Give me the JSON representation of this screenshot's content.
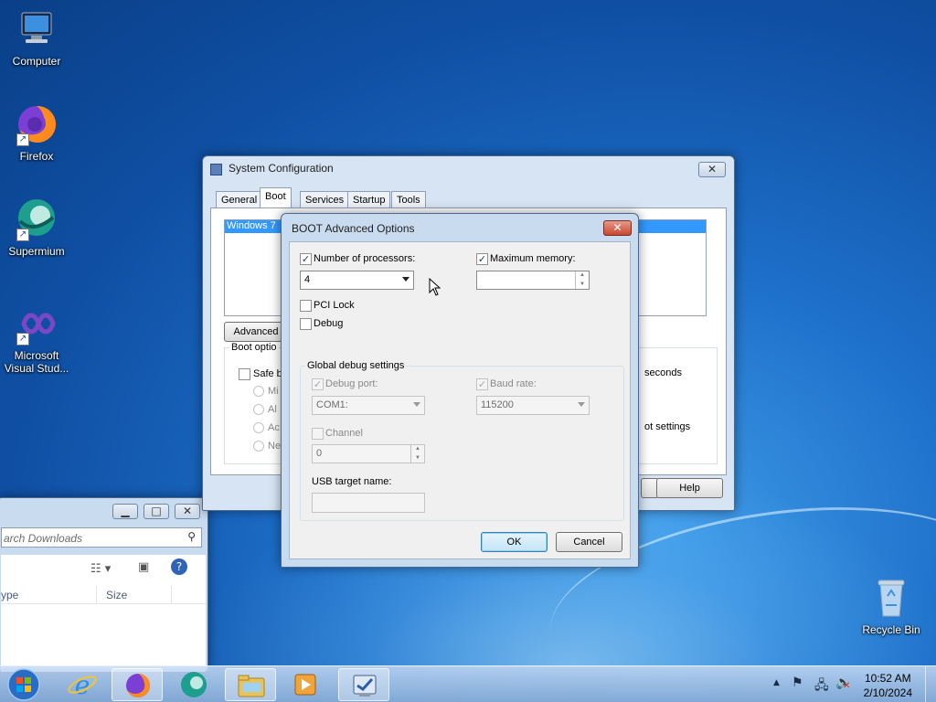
{
  "desktop": {
    "icons": [
      {
        "label": "Computer"
      },
      {
        "label": "Firefox"
      },
      {
        "label": "Supermium"
      },
      {
        "label": "Microsoft Visual Stud..."
      },
      {
        "label": "Recycle Bin"
      }
    ]
  },
  "system_config": {
    "title": "System Configuration",
    "tabs": [
      "General",
      "Boot",
      "Services",
      "Startup",
      "Tools"
    ],
    "active_tab": "Boot",
    "os_entry": "Windows 7",
    "advanced_button": "Advanced",
    "boot_options_label": "Boot optio",
    "safe_boot_label": "Safe b",
    "radio_labels": [
      "Mi",
      "Al",
      "Ac",
      "Ne"
    ],
    "seconds_label": "seconds",
    "boot_settings_label": "ot settings",
    "help_button": "Help"
  },
  "boot_advanced": {
    "title": "BOOT Advanced Options",
    "num_processors_label": "Number of processors:",
    "num_processors_checked": true,
    "num_processors_value": "4",
    "max_memory_label": "Maximum memory:",
    "max_memory_checked": true,
    "max_memory_value": "",
    "pci_lock_label": "PCI Lock",
    "pci_lock_checked": false,
    "debug_label": "Debug",
    "debug_checked": false,
    "global_debug_title": "Global debug settings",
    "debug_port_label": "Debug port:",
    "debug_port_value": "COM1:",
    "baud_rate_label": "Baud rate:",
    "baud_rate_value": "115200",
    "channel_label": "Channel",
    "channel_value": "0",
    "usb_target_label": "USB target name:",
    "usb_target_value": "",
    "ok_button": "OK",
    "cancel_button": "Cancel"
  },
  "explorer": {
    "search_placeholder": "arch Downloads",
    "col_type": "ype",
    "col_size": "Size"
  },
  "taskbar": {
    "time": "10:52 AM",
    "date": "2/10/2024"
  }
}
